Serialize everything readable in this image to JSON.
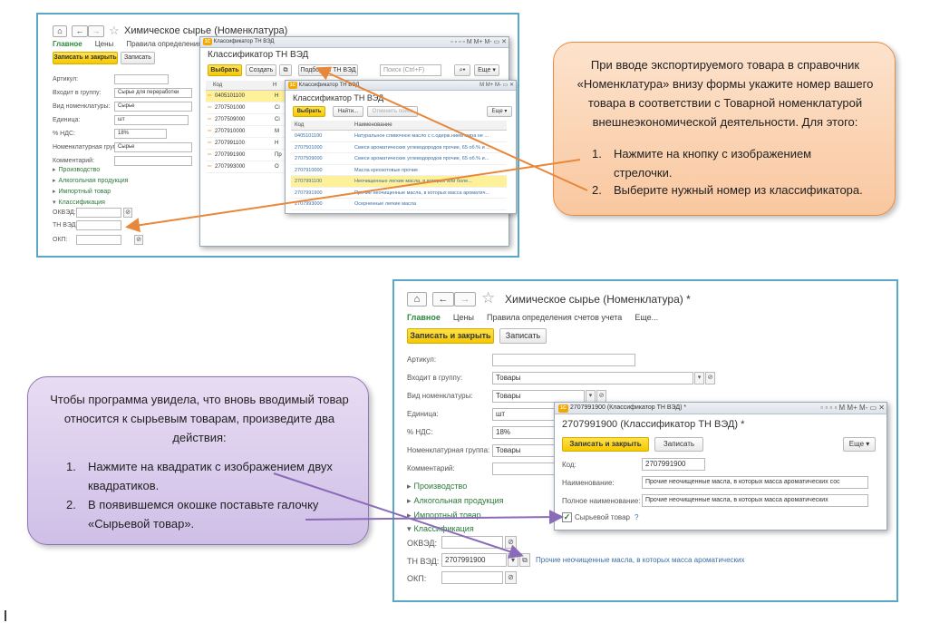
{
  "top": {
    "title": "Химическое сырье (Номенклатура)",
    "menu": [
      "Главное",
      "Цены",
      "Правила определения счетов"
    ],
    "save_close": "Записать и закрыть",
    "save": "Записать",
    "fields": [
      {
        "label": "Артикул:",
        "value": ""
      },
      {
        "label": "Входит в группу:",
        "value": "Сырье для переработки"
      },
      {
        "label": "Вид номенклатуры:",
        "value": "Сырье"
      },
      {
        "label": "Единица:",
        "value": "шт"
      },
      {
        "label": "% НДС:",
        "value": "18%"
      },
      {
        "label": "Номенклатурная группа:",
        "value": "Сырье"
      },
      {
        "label": "Комментарий:",
        "value": ""
      }
    ],
    "groups": [
      "Производство",
      "Алкогольная продукция",
      "Импортный товар",
      "Классификация"
    ],
    "okved": "ОКВЭД:",
    "tnved": "ТН ВЭД:",
    "okp": "ОКП:",
    "clf_title_bar": "Классификатор ТН ВЭД",
    "clf_heading": "Классификатор ТН ВЭД",
    "clf_select": "Выбрать",
    "clf_create": "Создать",
    "clf_pick": "Подбор из ТН ВЭД",
    "clf_search": "Поиск (Ctrl+F)",
    "clf_more": "Еще",
    "clf_col_code": "Код",
    "clf_col_name": "Н",
    "clf_codes": [
      "0405101100",
      "2707501000",
      "2707509000",
      "2707910000",
      "2707991100",
      "2707991900",
      "2707993000"
    ],
    "clf_names": [
      "Н",
      "Сі",
      "Сі",
      "М",
      "Н",
      "Пр",
      "О"
    ],
    "pick_title_bar": "Классификатор ТН ВЭД",
    "pick_heading": "Классификатор ТН ВЭД",
    "pick_select": "Выбрать",
    "pick_find": "Найти...",
    "pick_cancel": "Отменить поиск",
    "pick_more": "Еще",
    "pick_col_code": "Код",
    "pick_col_name": "Наименование",
    "pick_rows": [
      {
        "code": "0405101100",
        "name": "Натуральное сливочное масло с с.одерж.нием жира не ..."
      },
      {
        "code": "2707501000",
        "name": "Смеси ароматических углеводородов прочие, 65 об.% и ..."
      },
      {
        "code": "2707509000",
        "name": "Смеси ароматических углеводородов прочие, 65 об.% и..."
      },
      {
        "code": "2707910000",
        "name": "Масла креозотовые прочие"
      },
      {
        "code": "2707991100",
        "name": "Неочищенные легкие масла, в которых или боле..."
      },
      {
        "code": "2707991900",
        "name": "Прочие неочищенные масла, в которых масса ароматич..."
      },
      {
        "code": "2707993000",
        "name": "Осерненные легкие масла"
      }
    ]
  },
  "callout_top": {
    "text": "При вводе экспортируемого товара в справочник «Номенклатура» внизу формы укажите номер вашего товара в соответствии с Товарной номенклатурой внешнеэкономической деятельности. Для этого:",
    "steps": [
      "Нажмите на кнопку с изображением стрелочки.",
      "Выберите нужный номер из классификатора."
    ]
  },
  "bottom": {
    "title": "Химическое сырье (Номенклатура) *",
    "menu": [
      "Главное",
      "Цены",
      "Правила определения счетов учета",
      "Еще..."
    ],
    "save_close": "Записать и закрыть",
    "save": "Записать",
    "fields": [
      {
        "label": "Артикул:",
        "value": ""
      },
      {
        "label": "Входит в группу:",
        "value": "Товары"
      },
      {
        "label": "Вид номенклатуры:",
        "value": "Товары"
      },
      {
        "label": "Единица:",
        "value": "шт"
      },
      {
        "label": "% НДС:",
        "value": "18%"
      },
      {
        "label": "Номенклатурная группа:",
        "value": "Товары"
      },
      {
        "label": "Комментарий:",
        "value": ""
      }
    ],
    "groups": [
      "Производство",
      "Алкогольная продукция",
      "Импортный товар",
      "Классификация"
    ],
    "okved": "ОКВЭД:",
    "tnved": "ТН ВЭД:",
    "tnved_value": "2707991900",
    "tnved_link": "Прочие неочищенные масла, в которых масса ароматических",
    "okp": "ОКП:",
    "popup_title_bar": "2707991900 (Классификатор ТН ВЭД) *",
    "popup_heading": "2707991900 (Классификатор ТН ВЭД) *",
    "popup_save_close": "Записать и закрыть",
    "popup_save": "Записать",
    "popup_more": "Еще",
    "popup_code_label": "Код:",
    "popup_code": "2707991900",
    "popup_name_label": "Наименование:",
    "popup_name": "Прочие неочищенные масла, в которых масса ароматических сос",
    "popup_full_label": "Полное наименование:",
    "popup_full": "Прочие неочищенные масла, в которых масса ароматических",
    "popup_check_label": "Сырьевой товар",
    "popup_help": "?"
  },
  "callout_bottom": {
    "text": "Чтобы программа увидела, что вновь вводимый товар относится к сырьевым товарам, произведите два действия:",
    "steps": [
      "Нажмите на квадратик с изображением двух квадратиков.",
      "В появившемся окошке поставьте галочку «Сырьевой товар»."
    ]
  },
  "colors": {
    "frame": "#5aa8c8",
    "orange_arrow": "#e8873a",
    "purple_arrow": "#8a6bb8",
    "yellow": "#f5c800"
  }
}
